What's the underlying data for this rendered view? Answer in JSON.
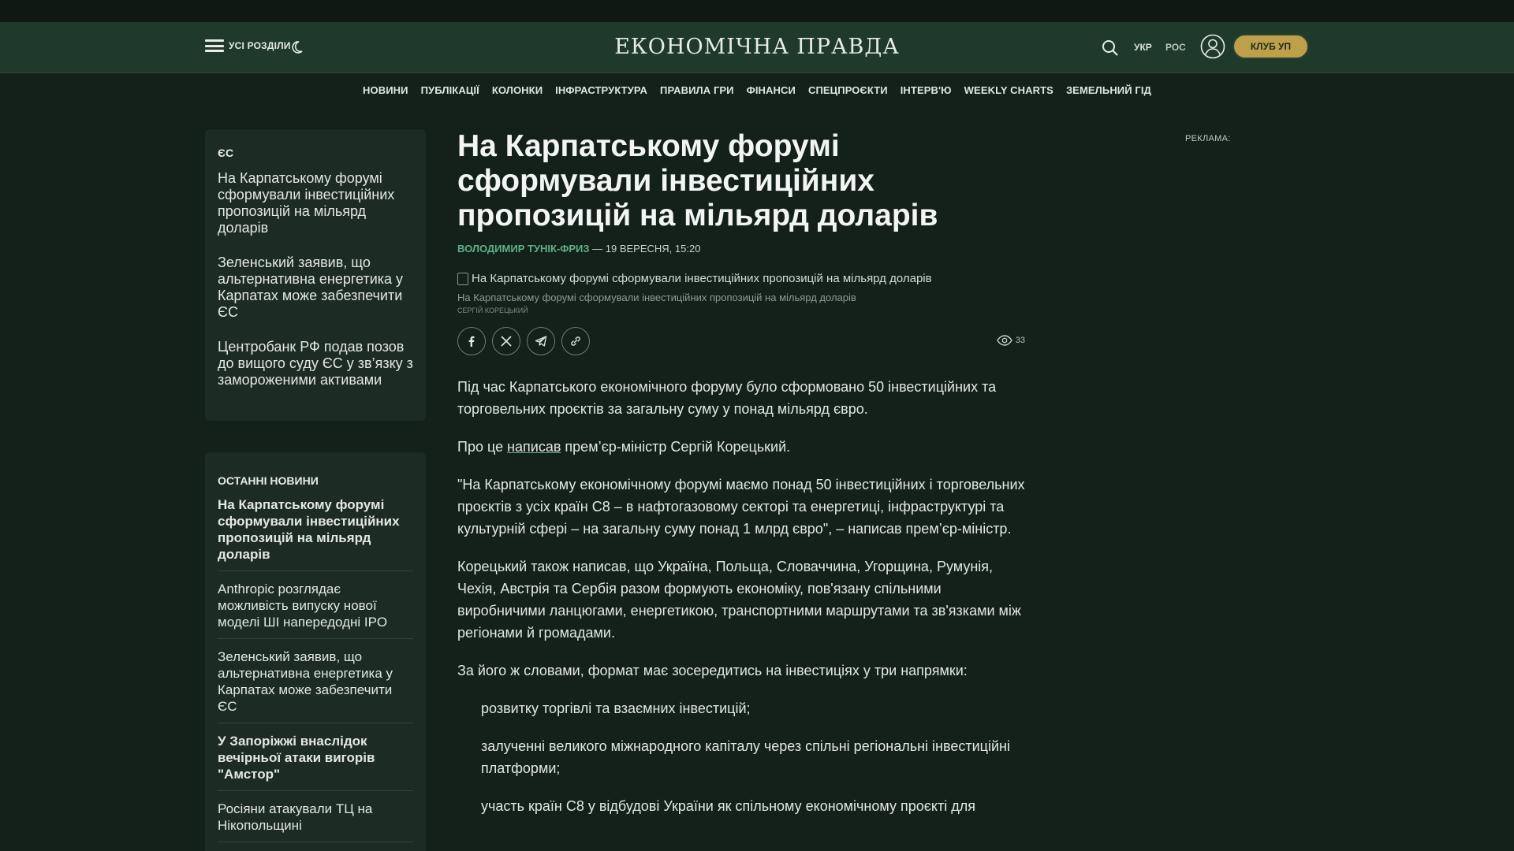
{
  "header": {
    "menu_label": "УСІ РОЗДІЛИ",
    "logo": "ЕКОНОМІЧНА ПРАВДА",
    "lang_ukr": "УКР",
    "lang_ros": "РОС",
    "club_label": "КЛУБ УП",
    "icons": [
      "burger-menu-icon",
      "moon-icon",
      "search-icon",
      "user-icon"
    ]
  },
  "nav": {
    "items": [
      "НОВИНИ",
      "ПУБЛІКАЦІЇ",
      "КОЛОНКИ",
      "ІНФРАСТРУКТУРА",
      "ПРАВИЛА ГРИ",
      "ФІНАНСИ",
      "СПЕЦПРОЄКТИ",
      "ІНТЕРВ'Ю",
      "WEEKLY CHARTS",
      "ЗЕМЕЛЬНИЙ ГІД"
    ]
  },
  "sidebar_es": {
    "category": "ЄС",
    "items": [
      "На Карпатському форумі сформували інвестиційних пропозицій на мільярд доларів",
      "Зеленський заявив, що альтернативна енергетика у Карпатах може забезпечити ЄС",
      "Центробанк РФ подав позов до вищого суду ЄС у зв’язку з замороженими активами"
    ]
  },
  "sidebar_latest": {
    "heading": "ОСТАННІ НОВИНИ",
    "items": [
      "На Карпатському форумі сформували інвестиційних пропозицій на мільярд доларів",
      "Anthropic розглядає можливість випуску нової моделі ШІ напередодні IPO",
      "Зеленський заявив, що альтернативна енергетика у Карпатах може забезпечити ЄС",
      "У Запоріжжі внаслідок вечірньої атаки вигорів \"Амстор\"",
      "Росіяни атакували ТЦ на Нікопольщині"
    ]
  },
  "article": {
    "title": "На Карпатському форумі сформували інвестиційних пропозицій на мільярд доларів",
    "author": "ВОЛОДИМИР ТУНІК-ФРИЗ",
    "date": " — 19 ВЕРЕСНЯ, 15:20",
    "image_alt": "На Карпатському форумі сформували інвестиційних пропозицій на мільярд доларів",
    "caption": "На Карпатському форумі сформували інвестиційних пропозицій на мільярд доларів",
    "credit": "СЕРГІЙ КОРЕЦЬКИЙ",
    "views": "33",
    "share_icons": [
      "facebook-icon",
      "x-icon",
      "telegram-icon",
      "copy-link-icon"
    ],
    "p1": "Під час Карпатського економічного форуму було сформовано 50 інвестиційних та торговельних проєктів за загальну суму у понад мільярд євро.",
    "p2_pre": "Про це ",
    "p2_link": "написав",
    "p2_post": " прем’єр-міністр Сергій Корецький.",
    "p3": "\"На Карпатському економічному форумі маємо понад 50 інвестиційних і торговельних проєктів з усіх країн С8 – в нафтогазовому секторі та енергетиці, інфраструктурі та культурній сфері – на загальну суму понад 1 млрд євро\", – написав прем’єр-міністр.",
    "p4": "Корецький також написав, що Україна, Польща, Словаччина, Угорщина, Румунія, Чехія, Австрія та Сербія разом формують економіку, пов'язану спільними виробничими ланцюгами, енергетикою, транспортними маршрутами та зв'язками між регіонами й громадами.",
    "p5": "За його ж словами, формат має зосередитись на інвестиціях у три напрямки:",
    "li1": "розвитку торгівлі та взаємних інвестицій;",
    "li2": "залученні великого міжнародного капіталу через спільні регіональні інвестиційні платформи;",
    "li3": "участь країн С8 у відбудові України як спільному економічному проєкті для"
  },
  "ad": {
    "label": "РЕКЛАМА:"
  },
  "colors": {
    "background": "#14201a",
    "header": "#1f3a2b",
    "accent": "#5fb08a",
    "club_button": "#bfa04a"
  }
}
